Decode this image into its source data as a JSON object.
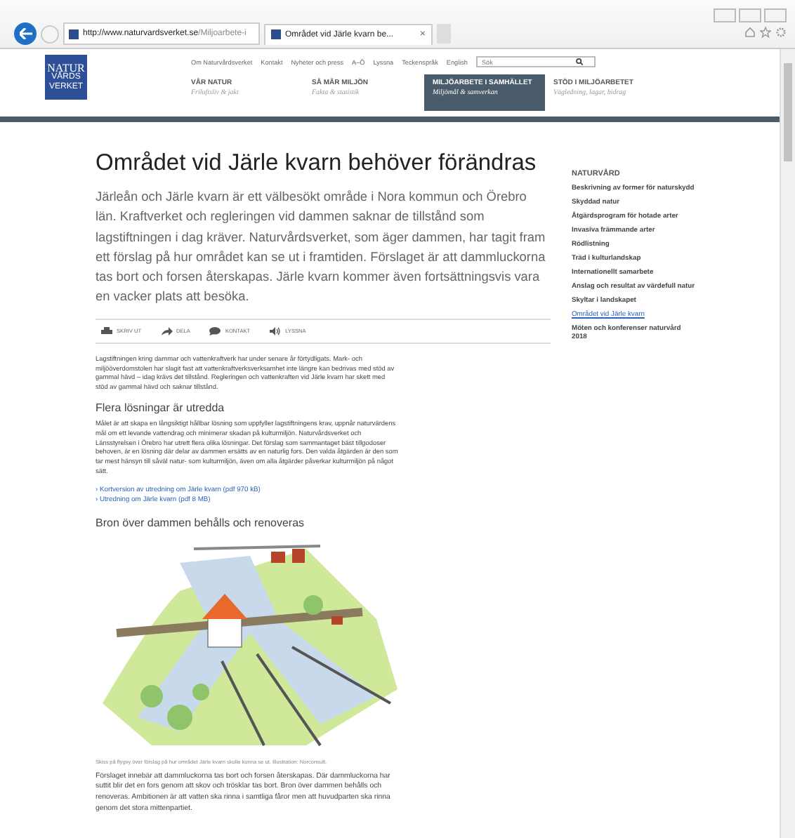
{
  "browser": {
    "address_host": "http://www.naturvardsverket.se",
    "address_path": "/Miljoarbete-i",
    "tab_title": "Området vid Järle kvarn be...",
    "tab_close": "×"
  },
  "header": {
    "logo_lines": [
      "NATUR",
      "VÅRDS",
      "VERKET"
    ],
    "top_links": [
      "Om Naturvårdsverket",
      "Kontakt",
      "Nyheter och press",
      "A–Ö",
      "Lyssna",
      "Teckenspråk",
      "English"
    ],
    "search": {
      "placeholder": "Sök"
    },
    "nav": [
      {
        "title": "VÅR NATUR",
        "subtitle": "Friluftsliv & jakt",
        "selected": false
      },
      {
        "title": "SÅ MÅR MILJÖN",
        "subtitle": "Fakta & statistik",
        "selected": false
      },
      {
        "title": "MILJÖARBETE I SAMHÄLLET",
        "subtitle": "Miljömål & samverkan",
        "selected": true
      },
      {
        "title": "STÖD I MILJÖARBETET",
        "subtitle": "Vägledning, lagar, bidrag",
        "selected": false
      }
    ]
  },
  "article": {
    "title": "Området vid Järle kvarn behöver förändras",
    "intro": "Järleån och Järle kvarn är ett välbesökt område i Nora kommun och Örebro län. Kraftverket och regleringen vid dammen saknar de tillstånd som lagstiftningen i dag kräver. Naturvårdsverket, som äger dammen, har tagit fram ett förslag på hur området kan se ut i framtiden. Förslaget är att dammluckorna tas bort och forsen återskapas. Järle kvarn kommer även fortsättningsvis vara en vacker plats att besöka.",
    "tools": [
      {
        "kind": "print",
        "label": "SKRIV UT"
      },
      {
        "kind": "share",
        "label": "DELA"
      },
      {
        "kind": "contact",
        "label": "KONTAKT"
      },
      {
        "kind": "listen",
        "label": "LYSSNA"
      }
    ],
    "paragraph_1": "Lagstiftningen kring dammar och vattenkraftverk har under senare år förtydligats. Mark- och miljööverdomstolen har slagit fast att vattenkraftverksverksamhet inte längre kan bedrivas med stöd av gammal hävd – idag krävs det tillstånd. Regleringen och vattenkraften vid Järle kvarn har skett med stöd av gammal hävd och saknar tillstånd.",
    "heading_1": "Flera lösningar är utredda",
    "paragraph_2": "Målet är att skapa en långsiktigt hållbar lösning som uppfyller lagstiftningens krav, uppnår naturvärdens mål om ett levande vattendrag och minimerar skadan på kulturmiljön. Naturvårdsverket och Länsstyrelsen i Örebro har utrett flera olika lösningar. Det förslag som sammantaget bäst tillgodoser behoven, är en lösning där delar av dammen ersätts av en naturlig fors. Den valda åtgärden är den som tar mest hänsyn till såväl natur- som kulturmiljön, även om alla åtgärder påverkar kulturmiljön på något sätt.",
    "links": [
      "› Kortversion av utredning om Järle kvarn (pdf 970 kB)",
      "› Utredning om Järle kvarn (pdf 8 MB)"
    ],
    "heading_2": "Bron över dammen behålls och renoveras",
    "caption": "Skiss på flygvy över förslag på hur området Järle kvarn skulle kunna se ut. Illustration: Norconsult.",
    "paragraph_3": "Förslaget innebär att dammluckorna tas bort och forsen återskapas. Där dammluckorna har suttit blir det en fors genom att skov och trösklar tas bort. Bron över dammen behålls och renoveras. Ambitionen är att vatten ska rinna i samtliga fåror men att huvudparten ska rinna genom det stora mittenpartiet."
  },
  "sidebar": {
    "title": "NATURVÅRD",
    "items": [
      {
        "label": "Beskrivning av former för naturskydd",
        "selected": false
      },
      {
        "label": "Skyddad natur",
        "selected": false
      },
      {
        "label": "Åtgärdsprogram för hotade arter",
        "selected": false
      },
      {
        "label": "Invasiva främmande arter",
        "selected": false
      },
      {
        "label": "Rödlistning",
        "selected": false
      },
      {
        "label": "Träd i kulturlandskap",
        "selected": false
      },
      {
        "label": "Internationellt samarbete",
        "selected": false
      },
      {
        "label": "Anslag och resultat av värdefull natur",
        "selected": false
      },
      {
        "label": "Skyltar i landskapet",
        "selected": false
      },
      {
        "label": "Området vid Järle kvarn",
        "selected": true
      },
      {
        "label": "Möten och konferenser naturvård 2018",
        "selected": false
      }
    ]
  }
}
